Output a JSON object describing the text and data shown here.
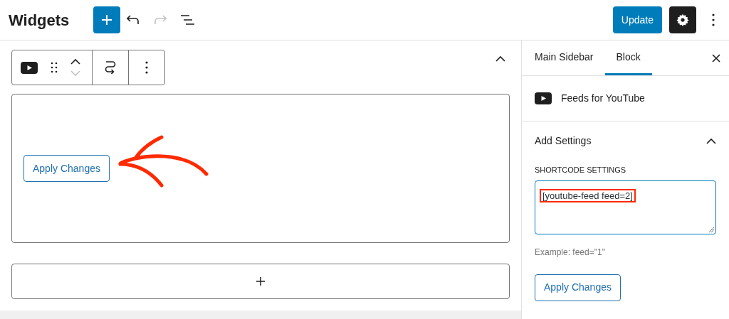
{
  "header": {
    "title": "Widgets",
    "update_button": "Update",
    "redo_disabled": true
  },
  "editor": {
    "block_button": "Apply Changes",
    "toolbar_move_down_disabled": true
  },
  "sidebar": {
    "tabs": [
      {
        "label": "Main Sidebar",
        "selected": false
      },
      {
        "label": "Block",
        "selected": true
      }
    ],
    "block_name": "Feeds for YouTube",
    "panel": {
      "title": "Add Settings",
      "expanded": true,
      "field_label": "SHORTCODE SETTINGS",
      "value": "[youtube-feed feed=2]",
      "help": "Example: feed=\"1\"",
      "button": "Apply Changes"
    }
  }
}
